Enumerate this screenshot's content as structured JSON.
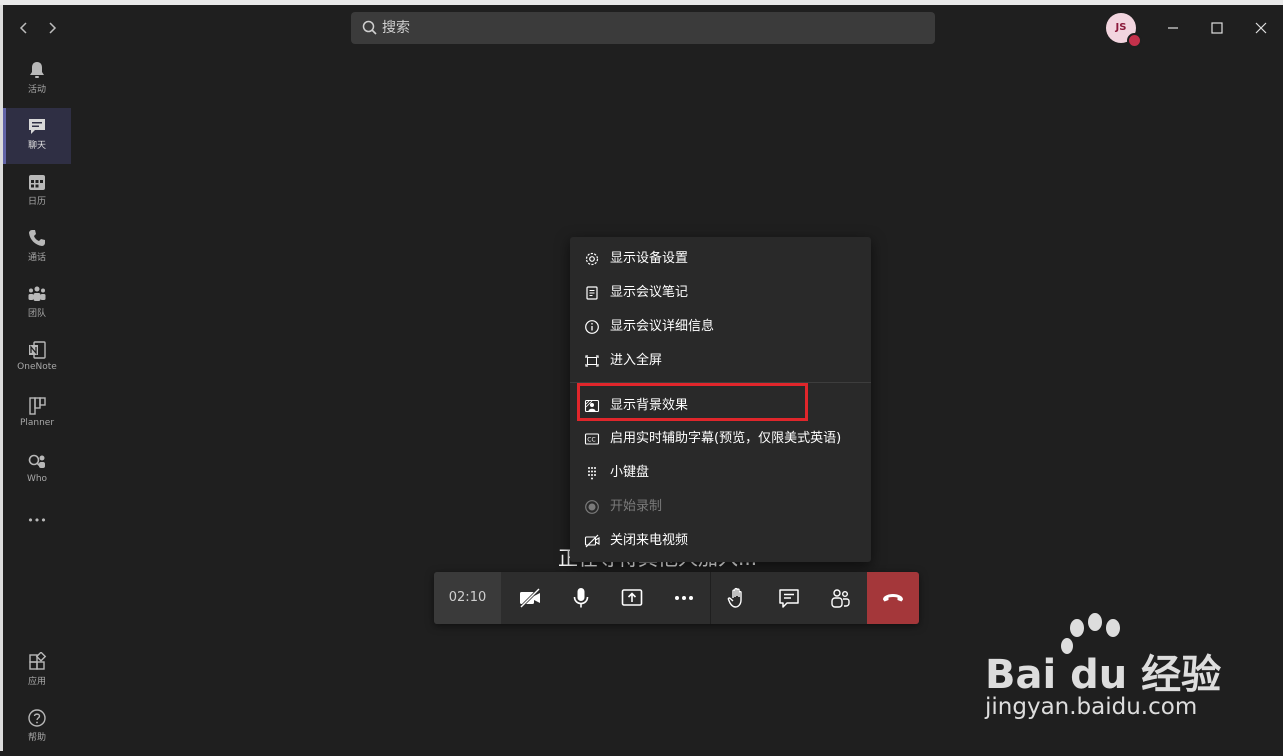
{
  "titlebar": {
    "search_placeholder": "搜索",
    "avatar_initials": "JS"
  },
  "rail": {
    "items": [
      {
        "label": "活动",
        "icon": "bell-icon"
      },
      {
        "label": "聊天",
        "icon": "chat-icon",
        "active": true
      },
      {
        "label": "日历",
        "icon": "calendar-icon"
      },
      {
        "label": "通话",
        "icon": "phone-icon"
      },
      {
        "label": "团队",
        "icon": "teams-icon"
      },
      {
        "label": "OneNote",
        "icon": "onenote-icon"
      },
      {
        "label": "Planner",
        "icon": "planner-icon"
      },
      {
        "label": "Who",
        "icon": "who-icon"
      },
      {
        "label": "应用",
        "icon": "apps-icon"
      },
      {
        "label": "帮助",
        "icon": "help-icon"
      }
    ],
    "more": "•••"
  },
  "stage": {
    "waiting_text": "正在等待其他人加入..."
  },
  "menu": {
    "items": [
      {
        "label": "显示设备设置",
        "icon": "gear-icon"
      },
      {
        "label": "显示会议笔记",
        "icon": "notes-icon"
      },
      {
        "label": "显示会议详细信息",
        "icon": "info-icon"
      },
      {
        "label": "进入全屏",
        "icon": "fullscreen-icon"
      },
      {
        "label": "显示背景效果",
        "icon": "background-effects-icon"
      },
      {
        "label": "启用实时辅助字幕(预览，仅限美式英语)",
        "icon": "captions-icon"
      },
      {
        "label": "小键盘",
        "icon": "dialpad-icon"
      },
      {
        "label": "开始录制",
        "icon": "record-icon",
        "disabled": true
      },
      {
        "label": "关闭来电视频",
        "icon": "video-off-icon"
      }
    ]
  },
  "callbar": {
    "timer": "02:10"
  },
  "watermark": {
    "brand": "Bai du 经验",
    "sub": "jingyan.baidu.com"
  },
  "colors": {
    "accent": "#6264a7",
    "hangup": "#a4373a",
    "highlight": "#e0262b"
  }
}
